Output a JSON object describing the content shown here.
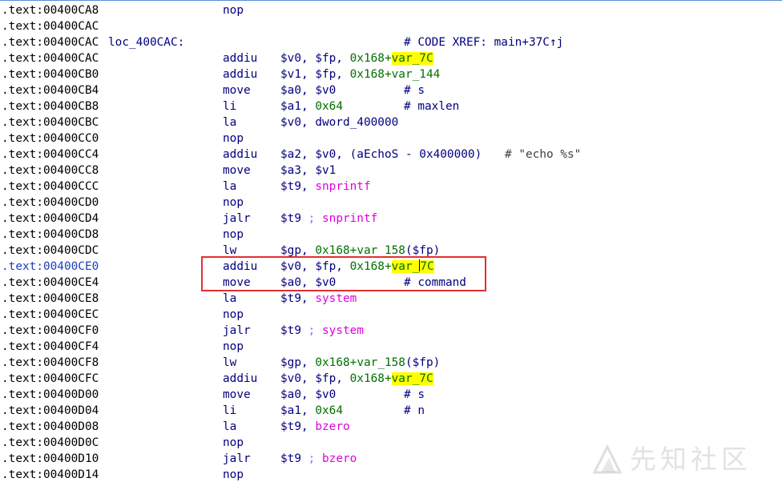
{
  "disasm": {
    "lines": [
      {
        "addr": ".text:00400CA8",
        "mnem": "nop"
      },
      {
        "addr": ".text:00400CAC"
      },
      {
        "addr": ".text:00400CAC",
        "label": "loc_400CAC:",
        "comment": "# CODE XREF: main+37C↑j"
      },
      {
        "addr": ".text:00400CAC",
        "mnem": "addiu",
        "ops_pre": "$v0, $fp, ",
        "ops_imm": "0x168",
        "ops_plus": "+",
        "ops_var": "var_7C"
      },
      {
        "addr": ".text:00400CB0",
        "mnem": "addiu",
        "ops_pre": "$v1, $fp, ",
        "ops_imm": "0x168",
        "ops_plus": "+",
        "ops_var": "var_144"
      },
      {
        "addr": ".text:00400CB4",
        "mnem": "move",
        "ops_pre": "$a0, $v0",
        "comment": "# s"
      },
      {
        "addr": ".text:00400CB8",
        "mnem": "li",
        "ops_pre": "$a1, ",
        "ops_imm": "0x64",
        "comment": "# maxlen"
      },
      {
        "addr": ".text:00400CBC",
        "mnem": "la",
        "ops_pre": "$v0, dword_400000"
      },
      {
        "addr": ".text:00400CC0",
        "mnem": "nop"
      },
      {
        "addr": ".text:00400CC4",
        "mnem": "addiu",
        "ops_pre": "$a2, $v0, (aEchoS - 0x400000)",
        "comment": "# \"echo %s\""
      },
      {
        "addr": ".text:00400CC8",
        "mnem": "move",
        "ops_pre": "$a3, $v1"
      },
      {
        "addr": ".text:00400CCC",
        "mnem": "la",
        "ops_pre": "$t9, ",
        "ops_fn": "snprintf"
      },
      {
        "addr": ".text:00400CD0",
        "mnem": "nop"
      },
      {
        "addr": ".text:00400CD4",
        "mnem": "jalr",
        "ops_pre": "$t9 ",
        "ops_sep": ";",
        "ops_fn": " snprintf"
      },
      {
        "addr": ".text:00400CD8",
        "mnem": "nop"
      },
      {
        "addr": ".text:00400CDC",
        "mnem": "lw",
        "ops_pre": "$gp, ",
        "ops_imm": "0x168",
        "ops_plus": "+",
        "ops_var": "var_158",
        "ops_post": "($fp)"
      },
      {
        "addr": ".text:00400CE0",
        "mnem": "addiu",
        "ops_pre": "$v0, $fp, ",
        "ops_imm": "0x168",
        "ops_plus": "+",
        "ops_var": "var_7C",
        "current": true
      },
      {
        "addr": ".text:00400CE4",
        "mnem": "move",
        "ops_pre": "$a0, $v0",
        "comment": "# command"
      },
      {
        "addr": ".text:00400CE8",
        "mnem": "la",
        "ops_pre": "$t9, ",
        "ops_fn": "system"
      },
      {
        "addr": ".text:00400CEC",
        "mnem": "nop"
      },
      {
        "addr": ".text:00400CF0",
        "mnem": "jalr",
        "ops_pre": "$t9 ",
        "ops_sep": ";",
        "ops_fn": " system"
      },
      {
        "addr": ".text:00400CF4",
        "mnem": "nop"
      },
      {
        "addr": ".text:00400CF8",
        "mnem": "lw",
        "ops_pre": "$gp, ",
        "ops_imm": "0x168",
        "ops_plus": "+",
        "ops_var": "var_158",
        "ops_post": "($fp)"
      },
      {
        "addr": ".text:00400CFC",
        "mnem": "addiu",
        "ops_pre": "$v0, $fp, ",
        "ops_imm": "0x168",
        "ops_plus": "+",
        "ops_var": "var_7C"
      },
      {
        "addr": ".text:00400D00",
        "mnem": "move",
        "ops_pre": "$a0, $v0",
        "comment": "# s"
      },
      {
        "addr": ".text:00400D04",
        "mnem": "li",
        "ops_pre": "$a1, ",
        "ops_imm": "0x64",
        "comment": "# n"
      },
      {
        "addr": ".text:00400D08",
        "mnem": "la",
        "ops_pre": "$t9, ",
        "ops_fn": "bzero"
      },
      {
        "addr": ".text:00400D0C",
        "mnem": "nop"
      },
      {
        "addr": ".text:00400D10",
        "mnem": "jalr",
        "ops_pre": "$t9 ",
        "ops_sep": ";",
        "ops_fn": " bzero"
      },
      {
        "addr": ".text:00400D14",
        "mnem": "nop"
      }
    ]
  },
  "watermark": {
    "text": "先知社区"
  },
  "colors": {
    "address": "#000000",
    "current_address": "#1a3fbf",
    "mnemonic": "#000080",
    "immediate": "#007000",
    "function": "#e000e0",
    "highlight": "#ffff00",
    "selection_box": "#e03030"
  }
}
